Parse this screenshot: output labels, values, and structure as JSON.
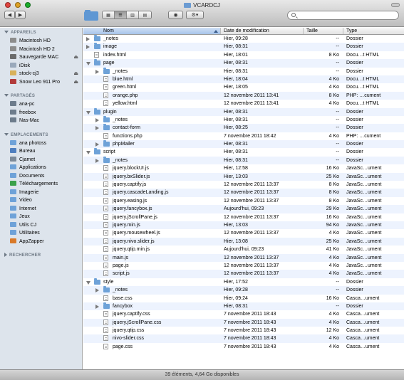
{
  "window": {
    "title": "VCARDCJ"
  },
  "toolbar": {
    "back_icon": "chevron-left-icon",
    "forward_icon": "chevron-right-icon",
    "view_modes": [
      "icon-view",
      "list-view",
      "column-view",
      "coverflow-view"
    ],
    "active_view": "list-view",
    "eye_icon": "quicklook-icon",
    "action_icon": "gear-icon",
    "search": {
      "value": "",
      "placeholder": ""
    }
  },
  "sidebar": {
    "sections": [
      {
        "title": "APPAREILS",
        "expanded": true,
        "items": [
          {
            "label": "Macintosh HD",
            "icon": "harddisk-icon",
            "eject": false,
            "color": "#8c8c8c"
          },
          {
            "label": "Macintosh HD 2",
            "icon": "harddisk-icon",
            "eject": false,
            "color": "#8c8c8c"
          },
          {
            "label": "Sauvegarde MAC",
            "icon": "harddisk-icon",
            "eject": true,
            "color": "#6b6b6b"
          },
          {
            "label": "iDisk",
            "icon": "idisk-icon",
            "eject": false,
            "color": "#9aa9bb"
          },
          {
            "label": "stock-cj3",
            "icon": "disk-icon",
            "eject": true,
            "color": "#d8b15a"
          },
          {
            "label": "Snow Leo 911 Pro",
            "icon": "disk-icon",
            "eject": true,
            "color": "#b23b3b"
          }
        ]
      },
      {
        "title": "PARTAGÉS",
        "expanded": true,
        "items": [
          {
            "label": "ana-pc",
            "icon": "computer-icon",
            "eject": false,
            "color": "#6d7c8c"
          },
          {
            "label": "freebox",
            "icon": "computer-icon",
            "eject": false,
            "color": "#6d7c8c"
          },
          {
            "label": "Nas-Mac",
            "icon": "computer-icon",
            "eject": false,
            "color": "#6d7c8c"
          }
        ]
      },
      {
        "title": "EMPLACEMENTS",
        "expanded": true,
        "items": [
          {
            "label": "ana photoss",
            "icon": "folder-icon",
            "eject": false,
            "color": "#6ea2d8"
          },
          {
            "label": "Bureau",
            "icon": "desktop-icon",
            "eject": false,
            "color": "#4f7fbf"
          },
          {
            "label": "Cjamet",
            "icon": "home-icon",
            "eject": false,
            "color": "#7c8a99"
          },
          {
            "label": "Applications",
            "icon": "applications-icon",
            "eject": false,
            "color": "#6ea2d8"
          },
          {
            "label": "Documents",
            "icon": "documents-icon",
            "eject": false,
            "color": "#6ea2d8"
          },
          {
            "label": "Téléchargements",
            "icon": "downloads-icon",
            "eject": false,
            "color": "#3aa14a"
          },
          {
            "label": "Imagerie",
            "icon": "pictures-icon",
            "eject": false,
            "color": "#6ea2d8"
          },
          {
            "label": "Video",
            "icon": "folder-icon",
            "eject": false,
            "color": "#6ea2d8"
          },
          {
            "label": "Internet",
            "icon": "folder-icon",
            "eject": false,
            "color": "#6ea2d8"
          },
          {
            "label": "Jeux",
            "icon": "folder-icon",
            "eject": false,
            "color": "#6ea2d8"
          },
          {
            "label": "Utils CJ",
            "icon": "folder-icon",
            "eject": false,
            "color": "#6ea2d8"
          },
          {
            "label": "Utilitaires",
            "icon": "utilities-icon",
            "eject": false,
            "color": "#6ea2d8"
          },
          {
            "label": "AppZapper",
            "icon": "appzapper-icon",
            "eject": false,
            "color": "#d97a2a"
          }
        ]
      },
      {
        "title": "RECHERCHER",
        "expanded": false,
        "items": []
      }
    ]
  },
  "columns": {
    "name": "Nom",
    "date": "Date de modification",
    "size": "Taille",
    "type": "Type"
  },
  "files": [
    {
      "name": "_notes",
      "date": "Hier, 09:28",
      "size": "--",
      "type": "Dossier",
      "level": 0,
      "kind": "folder",
      "disclosure": "closed"
    },
    {
      "name": "image",
      "date": "Hier, 08:31",
      "size": "--",
      "type": "Dossier",
      "level": 0,
      "kind": "folder",
      "disclosure": "closed"
    },
    {
      "name": "index.html",
      "date": "Hier, 18:01",
      "size": "8 Ko",
      "type": "Docu…t HTML",
      "level": 0,
      "kind": "file",
      "disclosure": "none"
    },
    {
      "name": "page",
      "date": "Hier, 08:31",
      "size": "--",
      "type": "Dossier",
      "level": 0,
      "kind": "folder",
      "disclosure": "open"
    },
    {
      "name": "_notes",
      "date": "Hier, 08:31",
      "size": "--",
      "type": "Dossier",
      "level": 1,
      "kind": "folder",
      "disclosure": "closed"
    },
    {
      "name": "blue.html",
      "date": "Hier, 18:04",
      "size": "4 Ko",
      "type": "Docu…t HTML",
      "level": 1,
      "kind": "file",
      "disclosure": "none"
    },
    {
      "name": "green.html",
      "date": "Hier, 18:05",
      "size": "4 Ko",
      "type": "Docu…t HTML",
      "level": 1,
      "kind": "file",
      "disclosure": "none"
    },
    {
      "name": "orange.php",
      "date": "12 novembre 2011 13:41",
      "size": "8 Ko",
      "type": "PHP: …cument",
      "level": 1,
      "kind": "file",
      "disclosure": "none"
    },
    {
      "name": "yellow.html",
      "date": "12 novembre 2011 13:41",
      "size": "4 Ko",
      "type": "Docu…t HTML",
      "level": 1,
      "kind": "file",
      "disclosure": "none"
    },
    {
      "name": "plugin",
      "date": "Hier, 08:31",
      "size": "--",
      "type": "Dossier",
      "level": 0,
      "kind": "folder",
      "disclosure": "open"
    },
    {
      "name": "_notes",
      "date": "Hier, 08:31",
      "size": "--",
      "type": "Dossier",
      "level": 1,
      "kind": "folder",
      "disclosure": "closed"
    },
    {
      "name": "contact-form",
      "date": "Hier, 08:25",
      "size": "--",
      "type": "Dossier",
      "level": 1,
      "kind": "folder",
      "disclosure": "closed"
    },
    {
      "name": "functions.php",
      "date": "7 novembre 2011 18:42",
      "size": "4 Ko",
      "type": "PHP: …cument",
      "level": 1,
      "kind": "file",
      "disclosure": "none"
    },
    {
      "name": "phpMailer",
      "date": "Hier, 08:31",
      "size": "--",
      "type": "Dossier",
      "level": 1,
      "kind": "folder",
      "disclosure": "closed"
    },
    {
      "name": "script",
      "date": "Hier, 08:31",
      "size": "--",
      "type": "Dossier",
      "level": 0,
      "kind": "folder",
      "disclosure": "open"
    },
    {
      "name": "_notes",
      "date": "Hier, 08:31",
      "size": "--",
      "type": "Dossier",
      "level": 1,
      "kind": "folder",
      "disclosure": "closed"
    },
    {
      "name": "jquery.blockUI.js",
      "date": "Hier, 12:58",
      "size": "16 Ko",
      "type": "JavaSc…ument",
      "level": 1,
      "kind": "file",
      "disclosure": "none"
    },
    {
      "name": "jquery.bxSlider.js",
      "date": "Hier, 13:03",
      "size": "25 Ko",
      "type": "JavaSc…ument",
      "level": 1,
      "kind": "file",
      "disclosure": "none"
    },
    {
      "name": "jquery.captify.js",
      "date": "12 novembre 2011 13:37",
      "size": "8 Ko",
      "type": "JavaSc…ument",
      "level": 1,
      "kind": "file",
      "disclosure": "none"
    },
    {
      "name": "jquery.cascadeLanding.js",
      "date": "12 novembre 2011 13:37",
      "size": "8 Ko",
      "type": "JavaSc…ument",
      "level": 1,
      "kind": "file",
      "disclosure": "none"
    },
    {
      "name": "jquery.easing.js",
      "date": "12 novembre 2011 13:37",
      "size": "8 Ko",
      "type": "JavaSc…ument",
      "level": 1,
      "kind": "file",
      "disclosure": "none"
    },
    {
      "name": "jquery.fancybox.js",
      "date": "Aujourd'hui, 09:23",
      "size": "29 Ko",
      "type": "JavaSc…ument",
      "level": 1,
      "kind": "file",
      "disclosure": "none"
    },
    {
      "name": "jquery.jScrollPane.js",
      "date": "12 novembre 2011 13:37",
      "size": "16 Ko",
      "type": "JavaSc…ument",
      "level": 1,
      "kind": "file",
      "disclosure": "none"
    },
    {
      "name": "jquery.min.js",
      "date": "Hier, 13:03",
      "size": "94 Ko",
      "type": "JavaSc…ument",
      "level": 1,
      "kind": "file",
      "disclosure": "none"
    },
    {
      "name": "jquery.mousewheel.js",
      "date": "12 novembre 2011 13:37",
      "size": "4 Ko",
      "type": "JavaSc…ument",
      "level": 1,
      "kind": "file",
      "disclosure": "none"
    },
    {
      "name": "jquery.nivo.slider.js",
      "date": "Hier, 13:08",
      "size": "25 Ko",
      "type": "JavaSc…ument",
      "level": 1,
      "kind": "file",
      "disclosure": "none"
    },
    {
      "name": "jquery.qtip.min.js",
      "date": "Aujourd'hui, 09:23",
      "size": "41 Ko",
      "type": "JavaSc…ument",
      "level": 1,
      "kind": "file",
      "disclosure": "none"
    },
    {
      "name": "main.js",
      "date": "12 novembre 2011 13:37",
      "size": "4 Ko",
      "type": "JavaSc…ument",
      "level": 1,
      "kind": "file",
      "disclosure": "none"
    },
    {
      "name": "page.js",
      "date": "12 novembre 2011 13:37",
      "size": "4 Ko",
      "type": "JavaSc…ument",
      "level": 1,
      "kind": "file",
      "disclosure": "none"
    },
    {
      "name": "script.js",
      "date": "12 novembre 2011 13:37",
      "size": "4 Ko",
      "type": "JavaSc…ument",
      "level": 1,
      "kind": "file",
      "disclosure": "none"
    },
    {
      "name": "style",
      "date": "Hier, 17:52",
      "size": "--",
      "type": "Dossier",
      "level": 0,
      "kind": "folder",
      "disclosure": "open"
    },
    {
      "name": "_notes",
      "date": "Hier, 09:28",
      "size": "--",
      "type": "Dossier",
      "level": 1,
      "kind": "folder",
      "disclosure": "closed"
    },
    {
      "name": "base.css",
      "date": "Hier, 09:24",
      "size": "16 Ko",
      "type": "Casca…ument",
      "level": 1,
      "kind": "file",
      "disclosure": "none"
    },
    {
      "name": "fancybox",
      "date": "Hier, 08:31",
      "size": "--",
      "type": "Dossier",
      "level": 1,
      "kind": "folder",
      "disclosure": "closed"
    },
    {
      "name": "jquery.captify.css",
      "date": "7 novembre 2011 18:43",
      "size": "4 Ko",
      "type": "Casca…ument",
      "level": 1,
      "kind": "file",
      "disclosure": "none"
    },
    {
      "name": "jquery.jScrollPane.css",
      "date": "7 novembre 2011 18:43",
      "size": "4 Ko",
      "type": "Casca…ument",
      "level": 1,
      "kind": "file",
      "disclosure": "none"
    },
    {
      "name": "jquery.qtip.css",
      "date": "7 novembre 2011 18:43",
      "size": "12 Ko",
      "type": "Casca…ument",
      "level": 1,
      "kind": "file",
      "disclosure": "none"
    },
    {
      "name": "nivo-slider.css",
      "date": "7 novembre 2011 18:43",
      "size": "4 Ko",
      "type": "Casca…ument",
      "level": 1,
      "kind": "file",
      "disclosure": "none"
    },
    {
      "name": "page.css",
      "date": "7 novembre 2011 18:43",
      "size": "4 Ko",
      "type": "Casca…ument",
      "level": 1,
      "kind": "file",
      "disclosure": "none"
    }
  ],
  "status": {
    "text": "39 éléments, 4,64 Go disponibles"
  }
}
